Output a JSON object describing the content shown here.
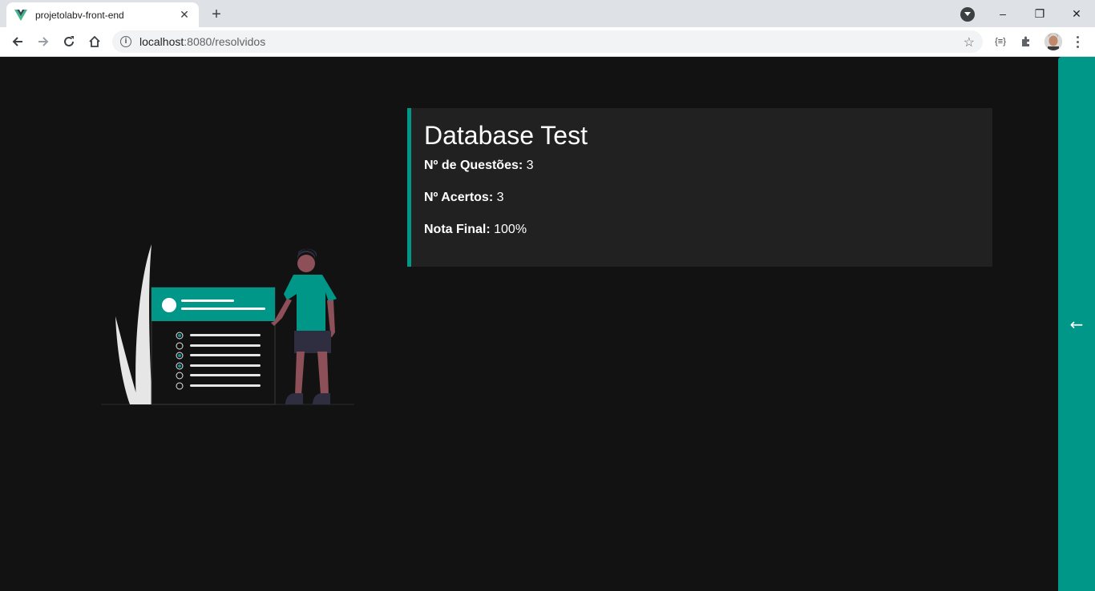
{
  "browser": {
    "tab_title": "projetolabv-front-end",
    "tab_close": "✕",
    "new_tab": "+",
    "url_host": "localhost",
    "url_rest": ":8080/resolvidos",
    "ext_label": "{≡}",
    "win_minimize": "–",
    "win_restore": "❐",
    "win_close": "✕"
  },
  "card": {
    "title": "Database Test",
    "questions_label": "Nº de Questões:",
    "questions_value": "3",
    "correct_label": "Nº Acertos:",
    "correct_value": "3",
    "grade_label": "Nota Final:",
    "grade_value": "100%"
  },
  "side_panel": {
    "arrow": "←"
  },
  "colors": {
    "accent": "#009688",
    "background": "#121212",
    "card": "#212121"
  }
}
